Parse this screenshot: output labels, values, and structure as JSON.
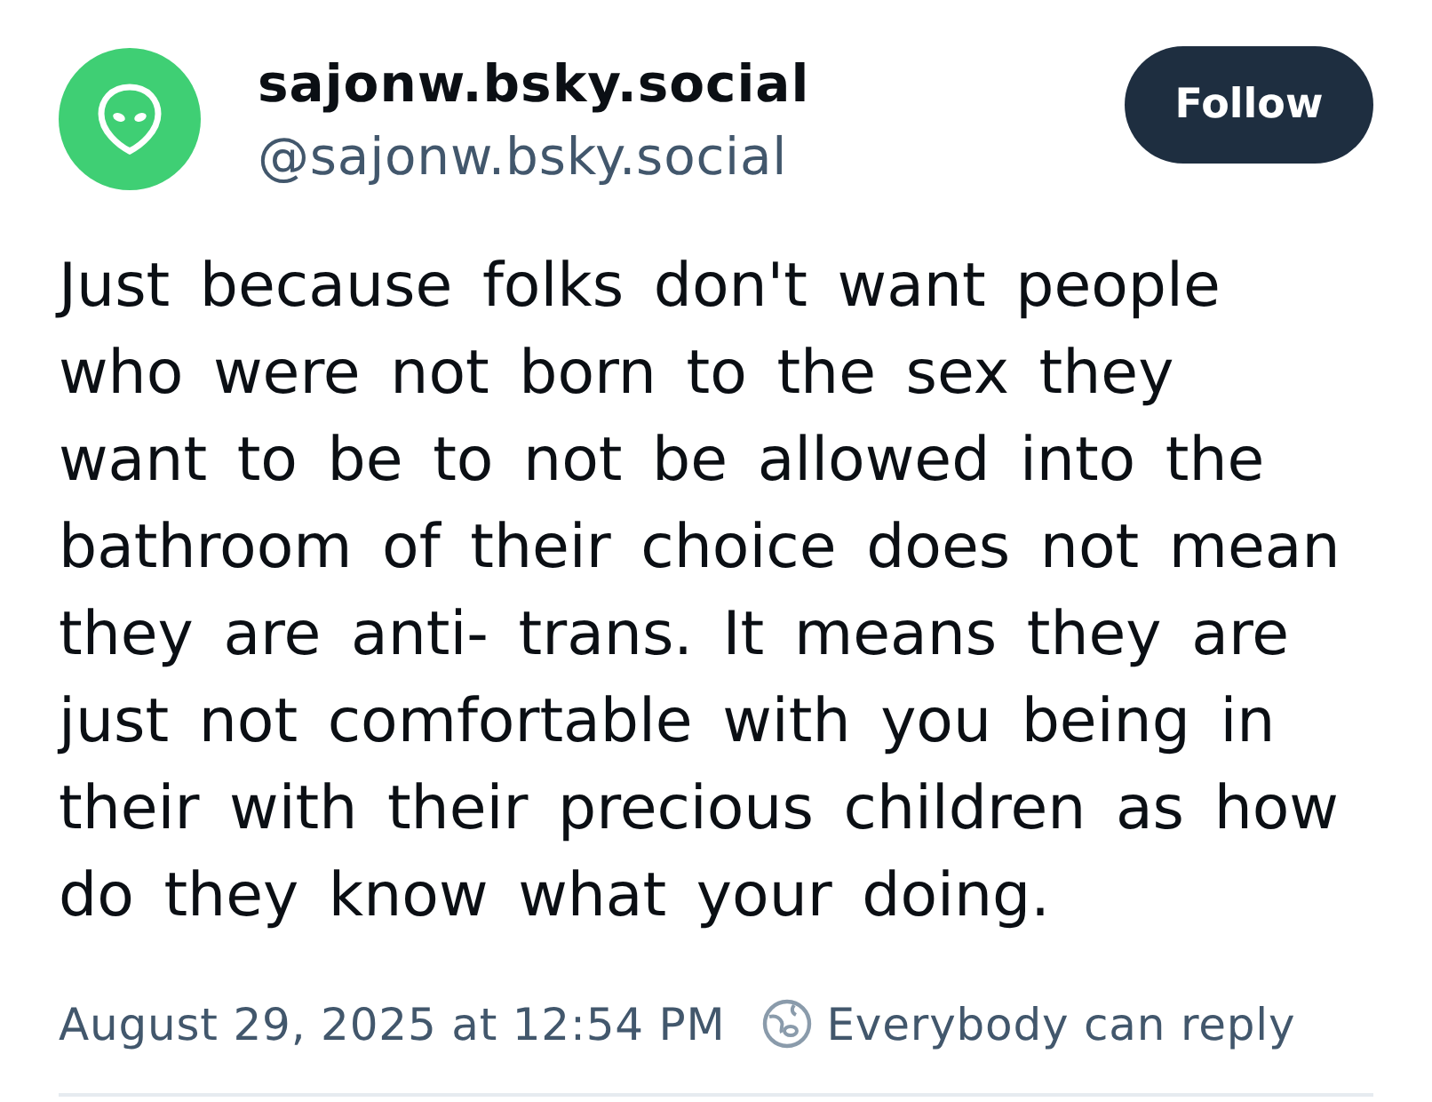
{
  "author": {
    "display_name": "sajonw.bsky.social",
    "handle": "@sajonw.bsky.social"
  },
  "follow_button": {
    "label": "Follow"
  },
  "post": {
    "text": "Just because folks don't want people who were not born to the sex they want to be to not be allowed into the bathroom of their choice does not mean they are anti- trans. It means they are just not comfortable with you being in their with their precious children as how do they know what your doing."
  },
  "footer": {
    "timestamp": "August 29, 2025 at 12:54 PM",
    "reply_setting": "Everybody can reply"
  }
}
